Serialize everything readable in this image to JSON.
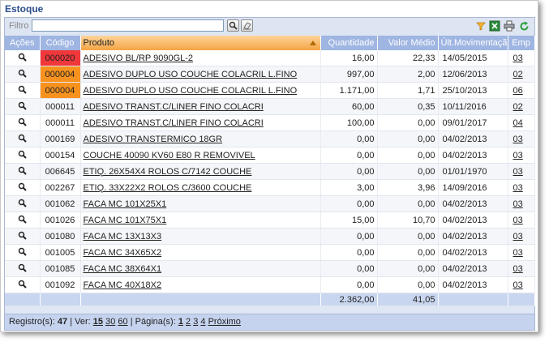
{
  "page": {
    "title": "Estoque"
  },
  "toolbar": {
    "filter_label": "Filtro",
    "filter_value": "",
    "icons": [
      "search-icon",
      "eraser-icon",
      "funnel-icon",
      "excel-icon",
      "printer-icon",
      "refresh-icon"
    ]
  },
  "columns": {
    "acoes": "Ações",
    "codigo": "Código",
    "produto": "Produto",
    "quantidade": "Quantidade",
    "valor_medio": "Valor Médio",
    "ult_mov": "Últ.Movimentação",
    "emp": "Emp"
  },
  "rows": [
    {
      "codigo": "000020",
      "produto": "ADESIVO BL/RP 9090GL-2",
      "quantidade": "16,00",
      "valor_medio": "22,33",
      "ult_mov": "14/05/2015",
      "emp": "03",
      "status": "red"
    },
    {
      "codigo": "000004",
      "produto": "ADESIVO DUPLO USO COUCHE COLACRIL L.FINO",
      "quantidade": "997,00",
      "valor_medio": "2,00",
      "ult_mov": "12/06/2013",
      "emp": "02",
      "status": "orange"
    },
    {
      "codigo": "000004",
      "produto": "ADESIVO DUPLO USO COUCHE COLACRIL L.FINO",
      "quantidade": "1.171,00",
      "valor_medio": "1,71",
      "ult_mov": "25/10/2013",
      "emp": "06",
      "status": "orange"
    },
    {
      "codigo": "000011",
      "produto": "ADESIVO TRANST.C/LINER FINO COLACRI",
      "quantidade": "60,00",
      "valor_medio": "0,35",
      "ult_mov": "10/11/2016",
      "emp": "02",
      "status": ""
    },
    {
      "codigo": "000011",
      "produto": "ADESIVO TRANST.C/LINER FINO COLACRI",
      "quantidade": "100,00",
      "valor_medio": "0,00",
      "ult_mov": "09/01/2017",
      "emp": "04",
      "status": ""
    },
    {
      "codigo": "000169",
      "produto": "ADESIVO TRANSTERMICO 18GR",
      "quantidade": "0,00",
      "valor_medio": "0,00",
      "ult_mov": "04/02/2013",
      "emp": "03",
      "status": ""
    },
    {
      "codigo": "000154",
      "produto": "COUCHE 40090 KV60 E80 R REMOVIVEL",
      "quantidade": "0,00",
      "valor_medio": "0,00",
      "ult_mov": "04/02/2013",
      "emp": "03",
      "status": ""
    },
    {
      "codigo": "006645",
      "produto": "ETIQ. 26X54X4 ROLOS C/7142 COUCHE",
      "quantidade": "0,00",
      "valor_medio": "0,00",
      "ult_mov": "01/01/1970",
      "emp": "03",
      "status": ""
    },
    {
      "codigo": "002267",
      "produto": "ETIQ. 33X22X2 ROLOS C/3600 COUCHE",
      "quantidade": "3,00",
      "valor_medio": "3,96",
      "ult_mov": "14/09/2016",
      "emp": "03",
      "status": ""
    },
    {
      "codigo": "001062",
      "produto": "FACA MC 101X25X1",
      "quantidade": "0,00",
      "valor_medio": "0,00",
      "ult_mov": "04/02/2013",
      "emp": "03",
      "status": ""
    },
    {
      "codigo": "001026",
      "produto": "FACA MC 101X75X1",
      "quantidade": "15,00",
      "valor_medio": "10,70",
      "ult_mov": "04/02/2013",
      "emp": "03",
      "status": ""
    },
    {
      "codigo": "001080",
      "produto": "FACA MC 13X13X3",
      "quantidade": "0,00",
      "valor_medio": "0,00",
      "ult_mov": "04/02/2013",
      "emp": "03",
      "status": ""
    },
    {
      "codigo": "001005",
      "produto": "FACA MC 34X65X2",
      "quantidade": "0,00",
      "valor_medio": "0,00",
      "ult_mov": "04/02/2013",
      "emp": "03",
      "status": ""
    },
    {
      "codigo": "001085",
      "produto": "FACA MC 38X64X1",
      "quantidade": "0,00",
      "valor_medio": "0,00",
      "ult_mov": "04/02/2013",
      "emp": "03",
      "status": ""
    },
    {
      "codigo": "001092",
      "produto": "FACA MC 40X18X2",
      "quantidade": "0,00",
      "valor_medio": "0,00",
      "ult_mov": "04/02/2013",
      "emp": "03",
      "status": ""
    }
  ],
  "totals": {
    "quantidade": "2.362,00",
    "valor_medio": "41,05"
  },
  "footer": {
    "registros_label": "Registro(s):",
    "registros_count": "47",
    "ver_label": "| Ver:",
    "page_sizes": [
      "15",
      "30",
      "60"
    ],
    "paginas_label": "| Página(s):",
    "pages": [
      "1",
      "2",
      "3",
      "4"
    ],
    "next_label": "Próximo"
  },
  "colors": {
    "header_bg": "#9fb5e2",
    "sorted_header": "#f5a445",
    "status_red": "#f0373a",
    "status_orange": "#f7921e",
    "title": "#2a4c8c"
  }
}
